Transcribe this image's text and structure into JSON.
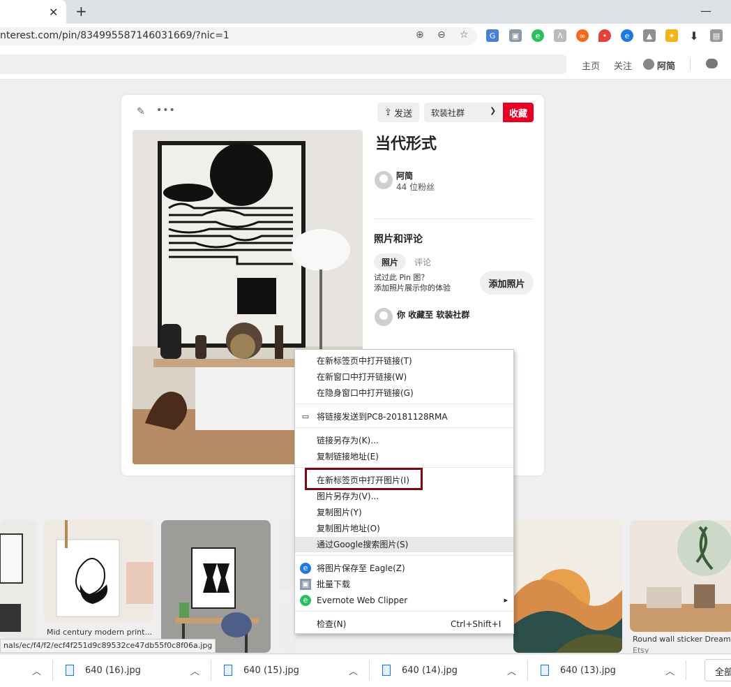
{
  "browser": {
    "url": "nterest.com/pin/834995587146031669/?nic=1",
    "tab_close": "✕",
    "new_tab": "+",
    "minimize": "—"
  },
  "pinterest": {
    "nav": {
      "home": "主页",
      "following": "关注",
      "user": "阿简"
    },
    "pin": {
      "send_label": "发送",
      "board": "软装社群",
      "save_label": "收藏",
      "title": "当代形式",
      "author": "阿简",
      "followers": "44 位粉丝",
      "photos_heading": "照片和评论",
      "tab_photos": "照片",
      "tab_comments": "评论",
      "try_text": "试过此 Pin 图？",
      "add_prompt": "添加照片展示你的体验",
      "add_photo": "添加照片",
      "saved_to": "你 收藏至 软装社群"
    },
    "related": [
      {
        "caption": "Mid century modern print..."
      },
      {
        "caption": "Round wall sticker Dreamy..."
      },
      {
        "caption": "Etsy"
      }
    ]
  },
  "context_menu": {
    "items": [
      "在新标签页中打开链接(T)",
      "在新窗口中打开链接(W)",
      "在隐身窗口中打开链接(G)",
      "将链接发送到PC8-20181128RMA",
      "链接另存为(K)...",
      "复制链接地址(E)",
      "在新标签页中打开图片(I)",
      "图片另存为(V)...",
      "复制图片(Y)",
      "复制图片地址(O)",
      "通过Google搜索图片(S)",
      "将图片保存至 Eagle(Z)",
      "批量下载",
      "Evernote Web Clipper",
      "检查(N)"
    ],
    "inspect_shortcut": "Ctrl+Shift+I",
    "submenu_arrow": "▸"
  },
  "status_url": "nals/ec/f4/f2/ecf4f251d9c89532ce47db55f0c8f06a.jpg",
  "downloads": {
    "items": [
      "640 (16).jpg",
      "640 (15).jpg",
      "640 (14).jpg",
      "640 (13).jpg"
    ],
    "show_all": "全部"
  },
  "colors": {
    "pinterest_red": "#e60023",
    "highlight_box": "#7a0a12"
  }
}
